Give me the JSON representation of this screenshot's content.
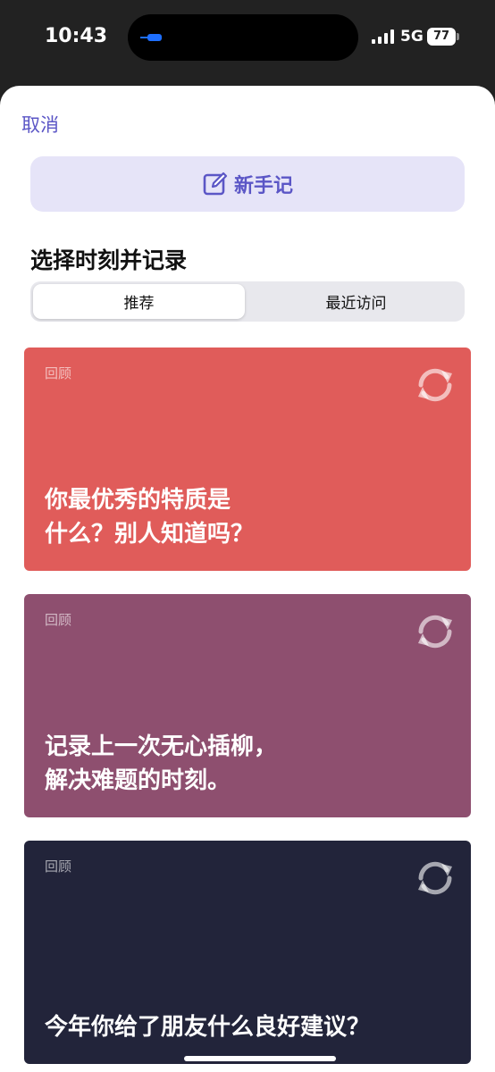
{
  "status_bar": {
    "time": "10:43",
    "network": "5G",
    "battery": "77"
  },
  "sheet": {
    "cancel_label": "取消",
    "new_note_label": "新手记",
    "new_note_icon": "compose-icon",
    "section_title": "选择时刻并记录",
    "segments": [
      {
        "label": "推荐",
        "selected": true
      },
      {
        "label": "最近访问",
        "selected": false
      }
    ]
  },
  "cards": [
    {
      "tag": "回顾",
      "text": "你最优秀的特质是\n什么？别人知道吗？",
      "color": "#e05c5a",
      "icon": "refresh-icon"
    },
    {
      "tag": "回顾",
      "text": "记录上一次无心插柳，\n解决难题的时刻。",
      "color": "#8e4f6f",
      "icon": "refresh-icon"
    },
    {
      "tag": "回顾",
      "text": "今年你给了朋友什么良好建议？",
      "color": "#22243a",
      "icon": "refresh-icon"
    }
  ],
  "colors": {
    "accent": "#5b56c6",
    "accent_bg": "#e6e4f8"
  }
}
